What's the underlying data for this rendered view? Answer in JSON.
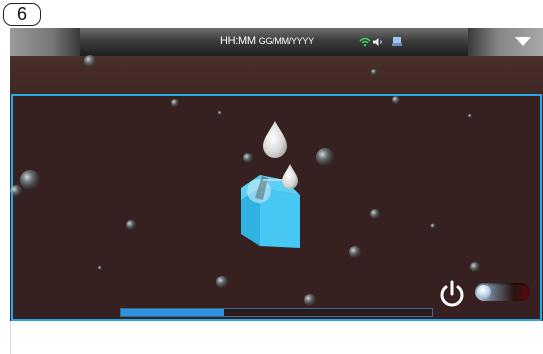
{
  "step_badge": "6",
  "statusbar": {
    "time": "HH:MM",
    "date": "GG/MM/YYYY",
    "icons": [
      "wifi-icon",
      "speaker-icon",
      "usb-icon"
    ],
    "menu_icon": "menu-arrow-icon"
  },
  "main": {
    "illustration_icon": "milk-carton-drops-icon",
    "power_icon": "power-icon",
    "toggle_state": "off",
    "progress_fraction": 0.33
  },
  "colors": {
    "accent": "#2aa7e8",
    "background": "#3b2423",
    "carton": "#3cc0ef",
    "progress": "#2e93e0"
  }
}
